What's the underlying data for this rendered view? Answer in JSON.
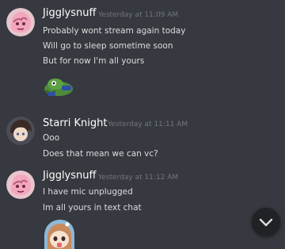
{
  "messages": [
    {
      "author": "Jigglysnuff",
      "timestamp": "Yesterday at 11:09 AM",
      "lines": [
        "Probably wont stream again today",
        "Will go to sleep sometime soon",
        "But for now I'm all yours"
      ],
      "attachment": "pepe-emote"
    },
    {
      "author": "Starri Knight",
      "timestamp": "Yesterday at 11:11 AM",
      "lines": [
        "Ooo",
        "Does that mean we can vc?"
      ]
    },
    {
      "author": "Jigglysnuff",
      "timestamp": "Yesterday at 11:12 AM",
      "lines": [
        "I have mic unplugged",
        "Im all yours in text chat"
      ],
      "attachment": "anime-girl-sticker"
    }
  ],
  "jump_button": {
    "icon": "chevron-down-icon"
  }
}
